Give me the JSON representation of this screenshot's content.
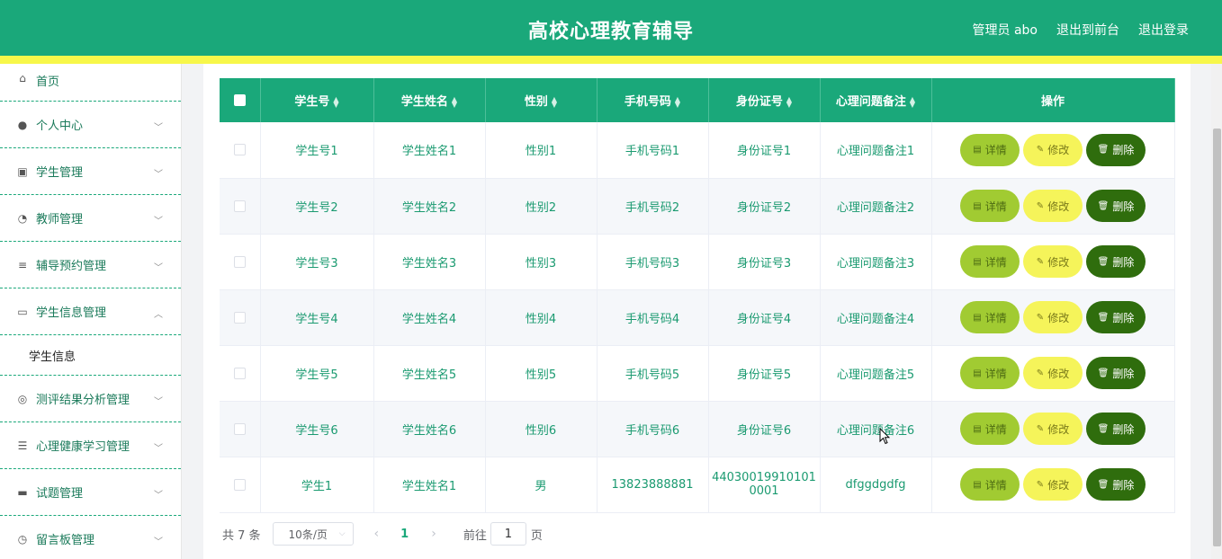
{
  "header": {
    "title": "高校心理教育辅导",
    "links": [
      "管理员 abo",
      "退出到前台",
      "退出登录"
    ]
  },
  "colors": {
    "primary": "#1aa87a",
    "accent_strip": "#f7f74a",
    "btn_detail": "#a1cb32",
    "btn_edit": "#f5f45a",
    "btn_delete": "#2f6d0d"
  },
  "sidebar": {
    "items": [
      {
        "label": "首页",
        "icon": "home-icon"
      },
      {
        "label": "个人中心",
        "icon": "user-icon"
      },
      {
        "label": "学生管理",
        "icon": "clipboard-icon"
      },
      {
        "label": "教师管理",
        "icon": "gauge-icon"
      },
      {
        "label": "辅导预约管理",
        "icon": "sliders-icon"
      },
      {
        "label": "学生信息管理",
        "icon": "chat-icon",
        "expanded": true
      },
      {
        "label": "测评结果分析管理",
        "icon": "compass-icon"
      },
      {
        "label": "心理健康学习管理",
        "icon": "list-icon"
      },
      {
        "label": "试题管理",
        "icon": "monitor-icon"
      },
      {
        "label": "留言板管理",
        "icon": "clock-icon"
      }
    ],
    "subitem": "学生信息"
  },
  "table": {
    "columns": [
      "学生号",
      "学生姓名",
      "性别",
      "手机号码",
      "身份证号",
      "心理问题备注",
      "操作"
    ],
    "actions": {
      "detail": "详情",
      "edit": "修改",
      "delete": "删除"
    },
    "rows": [
      [
        "学生号1",
        "学生姓名1",
        "性别1",
        "手机号码1",
        "身份证号1",
        "心理问题备注1"
      ],
      [
        "学生号2",
        "学生姓名2",
        "性别2",
        "手机号码2",
        "身份证号2",
        "心理问题备注2"
      ],
      [
        "学生号3",
        "学生姓名3",
        "性别3",
        "手机号码3",
        "身份证号3",
        "心理问题备注3"
      ],
      [
        "学生号4",
        "学生姓名4",
        "性别4",
        "手机号码4",
        "身份证号4",
        "心理问题备注4"
      ],
      [
        "学生号5",
        "学生姓名5",
        "性别5",
        "手机号码5",
        "身份证号5",
        "心理问题备注5"
      ],
      [
        "学生号6",
        "学生姓名6",
        "性别6",
        "手机号码6",
        "身份证号6",
        "心理问题备注6"
      ],
      [
        "学生1",
        "学生姓名1",
        "男",
        "13823888881",
        "440300199101010001",
        "dfggdgdfg"
      ]
    ]
  },
  "pagination": {
    "total": "共 7 条",
    "page_size": "10条/页",
    "current_page": "1",
    "goto_label": "前往",
    "goto_value": "1",
    "goto_unit": "页"
  }
}
